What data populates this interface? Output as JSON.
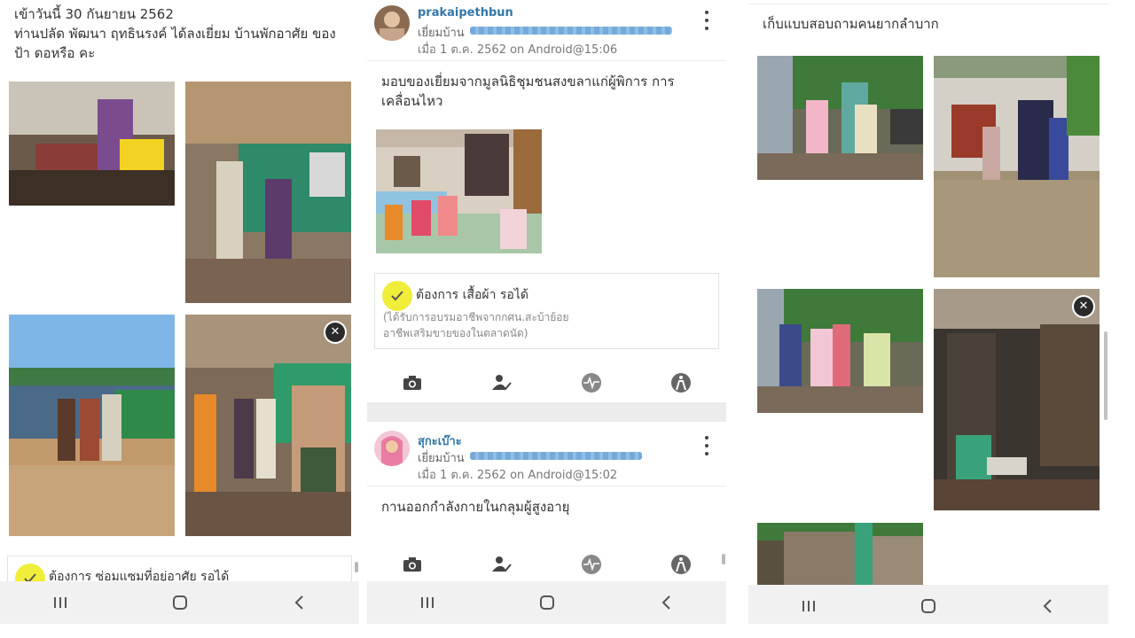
{
  "panel1": {
    "post_text": "เข้าวันนี้ 30 กันยายน 2562\nท่านปลัด พัฒนา ฤทธินรงค์ ได้ลงเยี่ยม บ้านพักอาศัย ของ ป้า ดอหรือ คะ",
    "need_label": "ต้องการ ซ่อมแซมที่อยู่อาศัย รอได้"
  },
  "panel2": {
    "post1": {
      "username": "prakaipethbun",
      "visit_prefix": "เยี่ยมบ้าน",
      "meta": "เมื่อ 1 ต.ค. 2562 on Android@15:06",
      "body": "มอบของเยี่ยมจากมูลนิธิชุมชนสงขลาแก่ผู้พิการ การเคลื่อนไหว",
      "need_label": "ต้องการ เสื้อผ้า รอได้",
      "need_note": "(ได้รับการอบรมอาชีพจากกศน.สะบ้าย้อย\nอาชีพเสริมขายของในตลาดนัด)"
    },
    "post2": {
      "username": "สุกะเบ๊าะ",
      "visit_prefix": "เยี่ยมบ้าน",
      "meta": "เมื่อ 1 ต.ค. 2562 on Android@15:02",
      "body": "กานออกกำลังกายในกลุมผู้สูงอายุ"
    }
  },
  "panel3": {
    "post_text": "เก็บแบบสอบถามคนยากลำบาก"
  },
  "icons": {
    "nav": [
      "recent-apps-icon",
      "home-icon",
      "back-icon"
    ],
    "actions": [
      "camera-icon",
      "user-check-icon",
      "health-pulse-icon",
      "disability-icon"
    ],
    "close": "close-icon",
    "check": "check-icon"
  },
  "colors": {
    "check_yellow": "#f0ee3a",
    "username_blue": "#3377a8",
    "navbar_gray": "#f1f1f1"
  }
}
